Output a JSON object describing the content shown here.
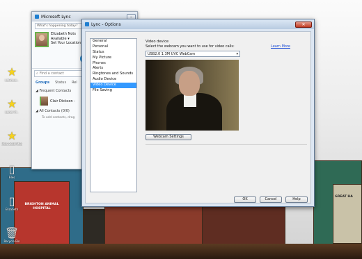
{
  "desktop": {
    "icons": [
      {
        "label": "LaGroue..",
        "glyph": "★"
      },
      {
        "label": "Lorier Pl..",
        "glyph": "★"
      },
      {
        "label": "MOS 2010 MCSD",
        "glyph": "★"
      },
      {
        "label": "Files",
        "glyph": "▯"
      },
      {
        "label": "Elizabeth",
        "glyph": "▯"
      },
      {
        "label": "Recycle Bin",
        "glyph": "🗑"
      }
    ],
    "signs": {
      "shop1": "BRIGHTON ANIMAL HOSPITAL",
      "shop2": "GREAT HA"
    }
  },
  "lync": {
    "title": "Microsoft Lync",
    "note_placeholder": "What's happening today?",
    "user_name": "Elizabeth Nots",
    "status": "Available",
    "location": "Set Your Location",
    "find_placeholder": "Find a contact",
    "tabs": [
      "Groups",
      "Status",
      "Rel"
    ],
    "frequent": "Frequent Contacts",
    "contact_name": "Clair Dickson -",
    "all_contacts": "All Contacts (0/0)",
    "add_hint": "To add contacts, drag"
  },
  "options": {
    "title": "Lync - Options",
    "nav": [
      "General",
      "Personal",
      "Status",
      "My Picture",
      "Phones",
      "Alerts",
      "Ringtones and Sounds",
      "Audio Device",
      "Video Device",
      "File Saving"
    ],
    "selected": "Video Device",
    "section_title": "Video device",
    "select_label": "Select the webcam you want to use for video calls:",
    "learn_more": "Learn More",
    "webcam_value": "USB2.0 1.3M UVC WebCam",
    "webcam_settings": "Webcam Settings",
    "ok": "OK",
    "cancel": "Cancel",
    "help": "Help"
  }
}
